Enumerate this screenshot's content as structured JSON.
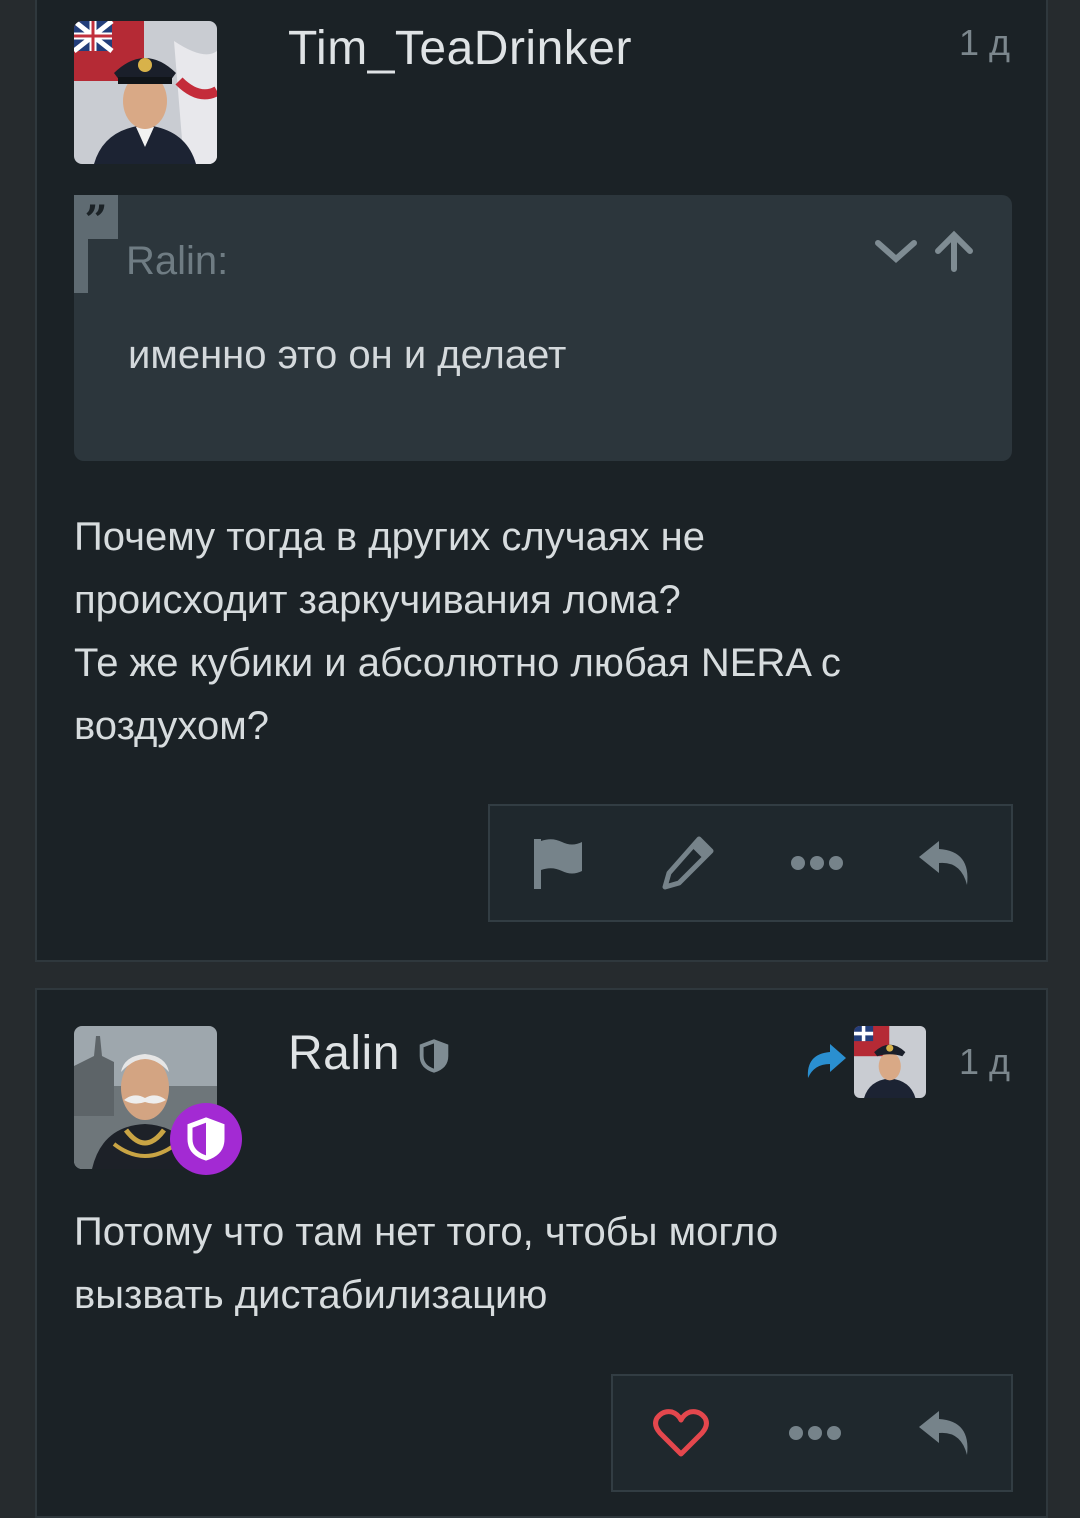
{
  "post1": {
    "username": "Tim_TeaDrinker",
    "time": "1 д",
    "quote": {
      "author": "Ralin:",
      "text": "именно это он и делает"
    },
    "body_lines": [
      "Почему тогда в других случаях не",
      "происходит заркучивания лома?",
      "Те же кубики и абсолютно любая NERA с",
      "воздухом?"
    ],
    "actions": [
      "flag-icon",
      "edit-icon",
      "more-icon",
      "reply-icon"
    ]
  },
  "post2": {
    "username": "Ralin",
    "time": "1 д",
    "body_lines": [
      "Потому что там нет того, чтобы могло",
      "вызвать дистабилизацию"
    ],
    "actions": [
      "heart-icon",
      "more-icon",
      "reply-icon"
    ]
  },
  "colors": {
    "background": "#1b2226",
    "quote_bg": "#2c363c",
    "admin_badge": "#a32ad3",
    "reply_arrow": "#2a8fd0",
    "like": "#e4474d"
  }
}
